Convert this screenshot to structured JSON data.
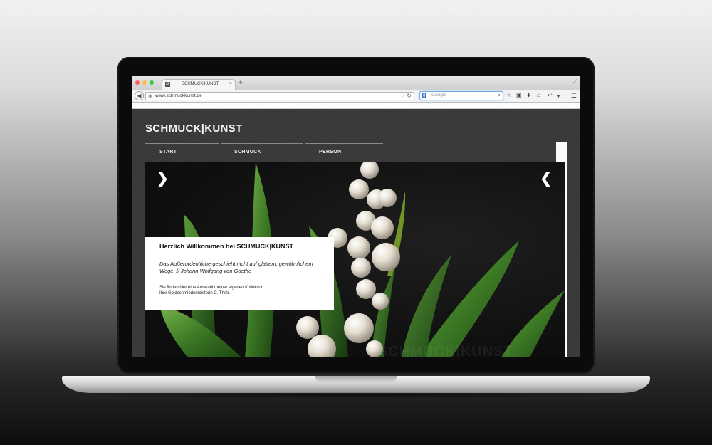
{
  "browser": {
    "tab_title": "SCHMUCK|KUNST",
    "tab_close": "×",
    "new_tab": "+",
    "url": "www.schmuckkunst.de",
    "search_placeholder": "Google",
    "icons": [
      "back-icon",
      "globe-icon",
      "reload-icon",
      "search-icon",
      "bookmark-star-icon",
      "clipboard-icon",
      "download-icon",
      "home-icon",
      "share-icon",
      "menu-icon"
    ]
  },
  "site": {
    "title": "SCHMUCK|KUNST",
    "nav": [
      {
        "label": "START"
      },
      {
        "label": "SCHMUCK"
      },
      {
        "label": "PERSON"
      }
    ],
    "hero": {
      "next_arrow": "❯",
      "prev_arrow": "❮",
      "watermark": "SCHMUCK|KUNST"
    },
    "welcome": {
      "heading": "Herzlich Willkommen bei SCHMUCK|KUNST",
      "quote": "Das Außerordentliche geschieht nicht auf glattem, gewöhnlichem Wege. // Johann Wolfgang von Goethe",
      "info_line1": "Sie finden hier eine Auswahl meiner eigenen Kollektion.",
      "info_line2": "Ihre Goldschmiedemeisterin C. Thols"
    }
  },
  "colors": {
    "background_dark": "#3a3a3a",
    "leaf_green": "#3f7d2a",
    "pearl": "#e9e4da",
    "accent_white": "#ffffff"
  }
}
